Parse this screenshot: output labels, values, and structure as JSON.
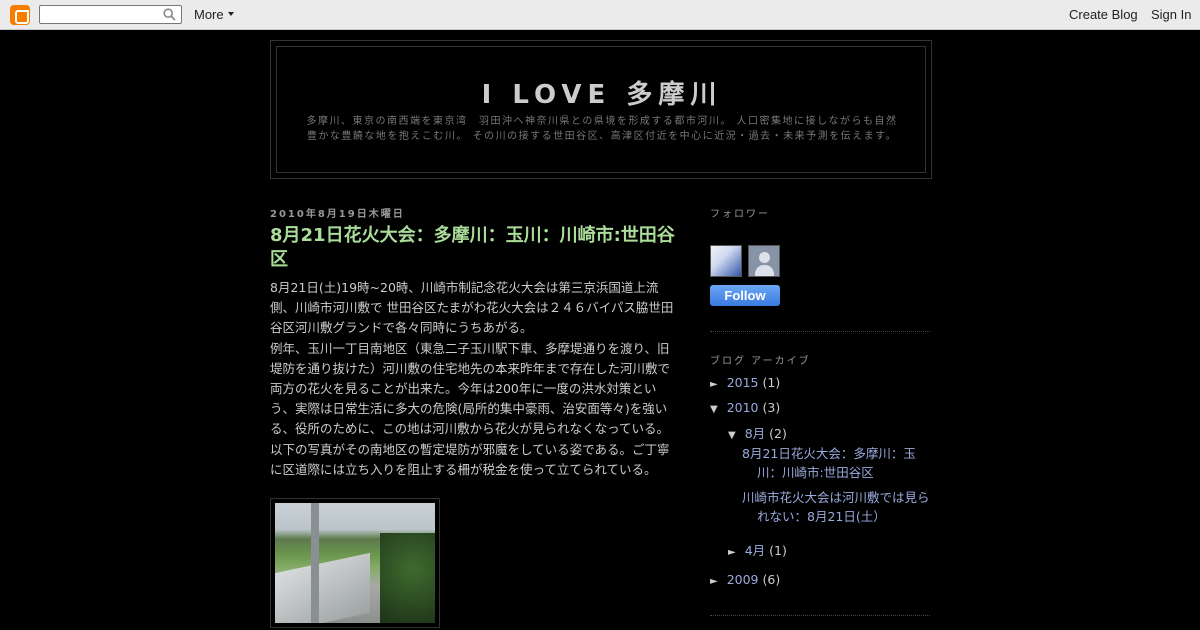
{
  "navbar": {
    "more_label": "More",
    "create_blog_label": "Create Blog",
    "sign_in_label": "Sign In",
    "search_value": "",
    "icons": {
      "logo": "blogger-logo-icon",
      "search": "search-icon",
      "dropdown": "chevron-down-icon"
    }
  },
  "header": {
    "title": "I LOVE 多摩川",
    "description": "多摩川、東京の南西端を東京湾　羽田沖へ神奈川県との県境を形成する都市河川。 人口密集地に接しながらも自然豊かな豊饒な地を抱えこむ川。 その川の接する世田谷区、高津区付近を中心に近況・過去・未来予測を伝えます。"
  },
  "post": {
    "date": "2010年8月19日木曜日",
    "title": "8月21日花火大会：多摩川：玉川：川崎市:世田谷区",
    "body_p1": "8月21日(土)19時~20時、川崎市制記念花火大会は第三京浜国道上流側、川崎市河川敷で 世田谷区たまがわ花火大会は２４６バイパス脇世田谷区河川敷グランドで各々同時にうちあがる。",
    "body_p2": "例年、玉川一丁目南地区（東急二子玉川駅下車、多摩堤通りを渡り、旧堤防を通り抜けた）河川敷の住宅地先の本来昨年まで存在した河川敷で両方の花火を見ることが出来た。今年は200年に一度の洪水対策という、実際は日常生活に多大の危険(局所的集中豪雨、治安面等々)を強いる、役所のために、この地は河川敷から花火が見られなくなっている。以下の写真がその南地区の暫定堤防が邪魔をしている姿である。ご丁寧に区道際には立ち入りを阻止する柵が税金を使って立てられている。"
  },
  "sidebar": {
    "followers_heading": "フォロワー",
    "follow_button": "Follow",
    "archive_heading": "ブログ アーカイブ",
    "archive": {
      "y2015": {
        "toggle": "►",
        "label": "2015",
        "count": "(1)"
      },
      "y2010": {
        "toggle": "▼",
        "label": "2010",
        "count": "(3)"
      },
      "aug": {
        "toggle": "▼",
        "label": "8月",
        "count": "(2)"
      },
      "aug_post_1": "8月21日花火大会：多摩川：玉川：川崎市:世田谷区",
      "aug_post_2": "川崎市花火大会は河川敷では見られない：8月21日(土）",
      "apr": {
        "toggle": "►",
        "label": "4月",
        "count": "(1)"
      },
      "y2009": {
        "toggle": "►",
        "label": "2009",
        "count": "(6)"
      }
    }
  },
  "colors": {
    "background": "#000000",
    "navbar": "#ebebeb",
    "post_title": "#aadd99",
    "link": "#99aadd",
    "text": "#cccccc",
    "follow_button": "#4d90fe",
    "blogger_orange": "#f57d00"
  }
}
